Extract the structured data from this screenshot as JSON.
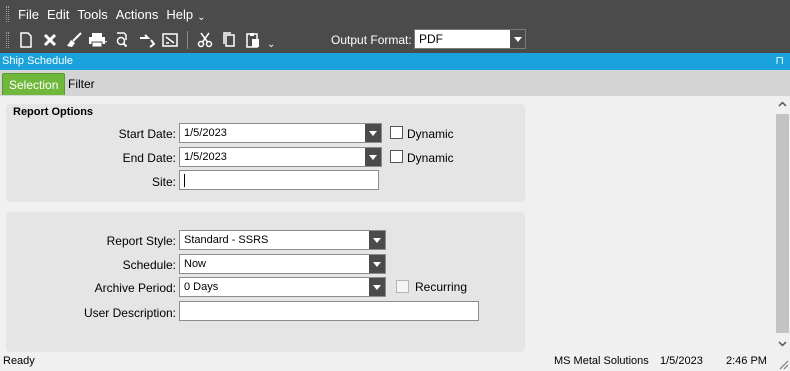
{
  "menu": {
    "items": [
      "File",
      "Edit",
      "Tools",
      "Actions",
      "Help"
    ],
    "more_glyph": "⌄"
  },
  "toolbar": {
    "icons": [
      "new-icon",
      "delete-icon",
      "clear-icon",
      "print-icon",
      "print-preview-icon",
      "refresh-icon",
      "transfer-icon",
      "cut-icon",
      "copy-icon",
      "paste-icon"
    ],
    "output_format_label": "Output Format:",
    "output_format_value": "PDF"
  },
  "titlebar": {
    "title": "Ship Schedule",
    "pin_glyph": "⊓"
  },
  "tabs": [
    {
      "label": "Selection",
      "active": true
    },
    {
      "label": "Filter",
      "active": false
    }
  ],
  "report_options": {
    "title": "Report Options",
    "start_date": {
      "label": "Start Date:",
      "value": "1/5/2023",
      "dynamic_label": "Dynamic",
      "dynamic_checked": false
    },
    "end_date": {
      "label": "End Date:",
      "value": "1/5/2023",
      "dynamic_label": "Dynamic",
      "dynamic_checked": false
    },
    "site": {
      "label": "Site:",
      "value": ""
    }
  },
  "report_settings": {
    "report_style": {
      "label": "Report Style:",
      "value": "Standard - SSRS"
    },
    "schedule": {
      "label": "Schedule:",
      "value": "Now"
    },
    "archive_period": {
      "label": "Archive Period:",
      "value": "0 Days",
      "recurring_label": "Recurring",
      "recurring_checked": false
    },
    "user_description": {
      "label": "User Description:",
      "value": ""
    }
  },
  "status": {
    "state": "Ready",
    "company": "MS Metal Solutions",
    "date": "1/5/2023",
    "time": "2:46 PM"
  },
  "colors": {
    "toolbar_bg": "#4b4b4b",
    "title_bar": "#1aa2dc",
    "active_tab": "#70b83b"
  }
}
